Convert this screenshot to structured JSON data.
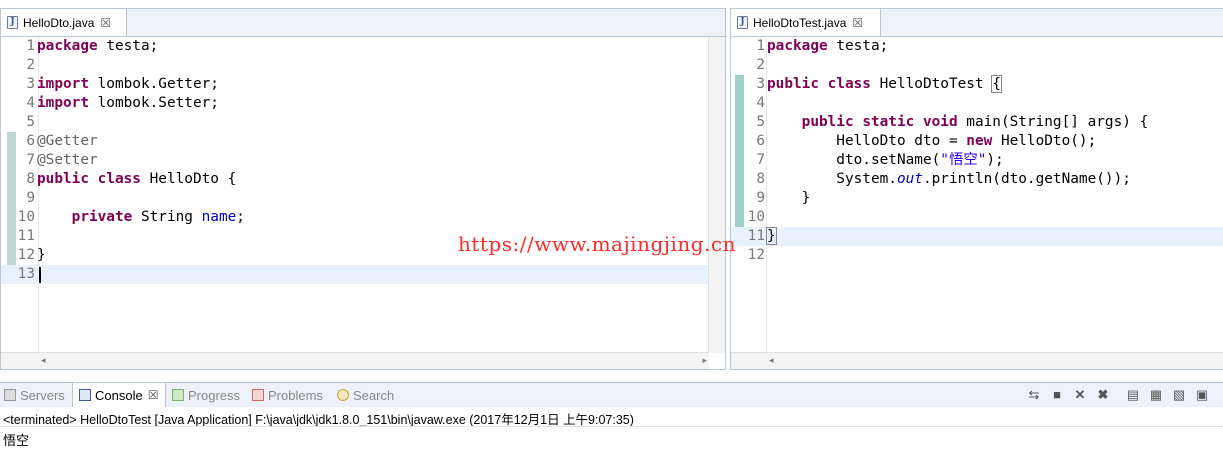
{
  "left_editor": {
    "tab_label": "HelloDto.java",
    "close_glyph": "☒",
    "lines": [
      {
        "n": "1",
        "html": "<span class=\"kw\">package</span> testa;"
      },
      {
        "n": "2",
        "html": ""
      },
      {
        "n": "3",
        "html": "<span class=\"kw\">import</span> lombok.Getter;"
      },
      {
        "n": "4",
        "html": "<span class=\"kw\">import</span> lombok.Setter;"
      },
      {
        "n": "5",
        "html": ""
      },
      {
        "n": "6",
        "html": "<span class=\"ann\">@Getter</span>"
      },
      {
        "n": "7",
        "html": "<span class=\"ann\">@Setter</span>"
      },
      {
        "n": "8",
        "html": "<span class=\"kw\">public</span> <span class=\"kw\">class</span> HelloDto {"
      },
      {
        "n": "9",
        "html": ""
      },
      {
        "n": "10",
        "html": "    <span class=\"kw\">private</span> String <span class=\"fld\">name</span>;"
      },
      {
        "n": "11",
        "html": ""
      },
      {
        "n": "12",
        "html": "}"
      },
      {
        "n": "13",
        "html": ""
      }
    ]
  },
  "right_editor": {
    "tab_label": "HelloDtoTest.java",
    "close_glyph": "☒",
    "lines": [
      {
        "n": "1",
        "html": "<span class=\"kw\">package</span> testa;"
      },
      {
        "n": "2",
        "html": ""
      },
      {
        "n": "3",
        "html": "<span class=\"kw\">public</span> <span class=\"kw\">class</span> HelloDtoTest <span style=\"outline:1px solid #888\">{</span>"
      },
      {
        "n": "4",
        "html": ""
      },
      {
        "n": "5",
        "html": "    <span class=\"kw\">public</span> <span class=\"kw\">static</span> <span class=\"kw\">void</span> main(String[] args) {"
      },
      {
        "n": "6",
        "html": "        HelloDto dto = <span class=\"kw\">new</span> HelloDto();"
      },
      {
        "n": "7",
        "html": "        dto.setName(<span class=\"str\">\"悟空\"</span>);"
      },
      {
        "n": "8",
        "html": "        System.<span class=\"static\">out</span>.println(dto.getName());"
      },
      {
        "n": "9",
        "html": "    }"
      },
      {
        "n": "10",
        "html": ""
      },
      {
        "n": "11",
        "html": "<span style=\"outline:1px solid #888\">}</span>"
      },
      {
        "n": "12",
        "html": ""
      }
    ]
  },
  "watermark": "https://www.majingjing.cn",
  "console": {
    "tabs": [
      {
        "label": "Servers",
        "icon": "servers-icon"
      },
      {
        "label": "Console",
        "icon": "console-icon",
        "close": "☒"
      },
      {
        "label": "Progress",
        "icon": "progress-icon"
      },
      {
        "label": "Problems",
        "icon": "problems-icon"
      },
      {
        "label": "Search",
        "icon": "search-icon"
      }
    ],
    "status": "<terminated> HelloDtoTest [Java Application] F:\\java\\jdk\\jdk1.8.0_151\\bin\\javaw.exe (2017年12月1日 上午9:07:35)",
    "output": "悟空"
  }
}
